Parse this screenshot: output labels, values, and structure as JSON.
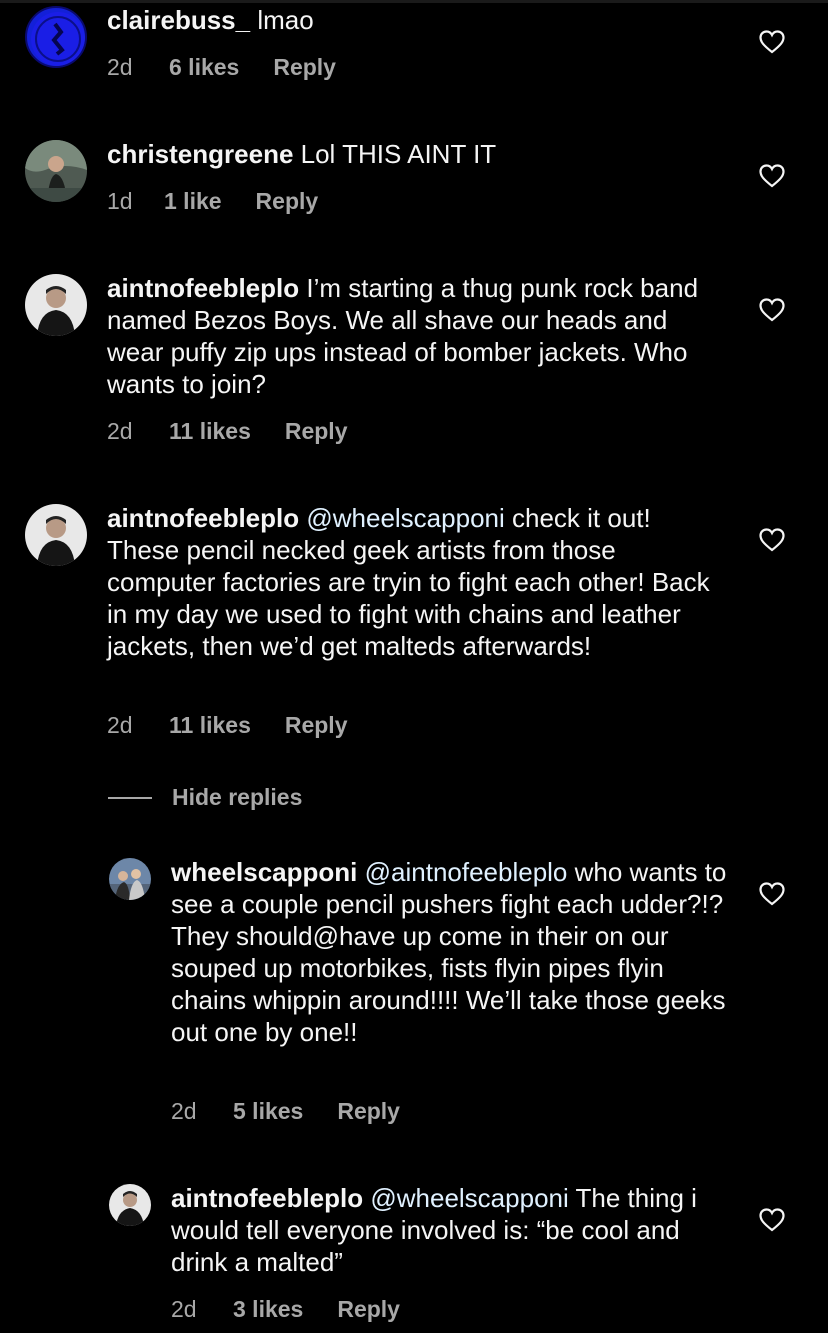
{
  "comments": [
    {
      "user": "clairebuss_",
      "text": "lmao",
      "time": "2d",
      "likes": "6 likes",
      "reply": "Reply"
    },
    {
      "user": "christengreene",
      "text": "Lol THIS AINT IT",
      "time": "1d",
      "likes": "1 like",
      "reply": "Reply"
    },
    {
      "user": "aintnofeebleplo",
      "text": "I’m starting a thug punk rock band named Bezos Boys. We all shave our heads and wear puffy zip ups instead of bomber jackets. Who wants to join?",
      "time": "2d",
      "likes": "11 likes",
      "reply": "Reply"
    },
    {
      "user": "aintnofeebleplo",
      "text": "@wheelscapponi check it out! These pencil necked geek artists from those computer factories are tryin to fight each other! Back in my day we used to fight with chains and leather jackets, then we’d get malteds afterwards!",
      "time": "2d",
      "likes": "11 likes",
      "reply": "Reply"
    }
  ],
  "hide_replies": "Hide replies",
  "replies": [
    {
      "user": "wheelscapponi",
      "text": "@aintnofeebleplo who wants to see a couple pencil pushers fight each udder?!? They should@have up come in their on our  souped up motorbikes, fists flyin pipes flyin chains whippin around!!!! We’ll take those geeks out one by one!!",
      "time": "2d",
      "likes": "5 likes",
      "reply": "Reply"
    },
    {
      "user": "aintnofeebleplo",
      "text": "@wheelscapponi The thing i would tell everyone involved is: “be cool and drink a malted”",
      "time": "2d",
      "likes": "3 likes",
      "reply": "Reply"
    }
  ],
  "colors": {
    "background": "#000000",
    "text": "#f5f5f5",
    "meta": "#a8a8a8",
    "mention": "#e0f1ff"
  },
  "icons": {
    "like": "heart-outline-icon"
  }
}
